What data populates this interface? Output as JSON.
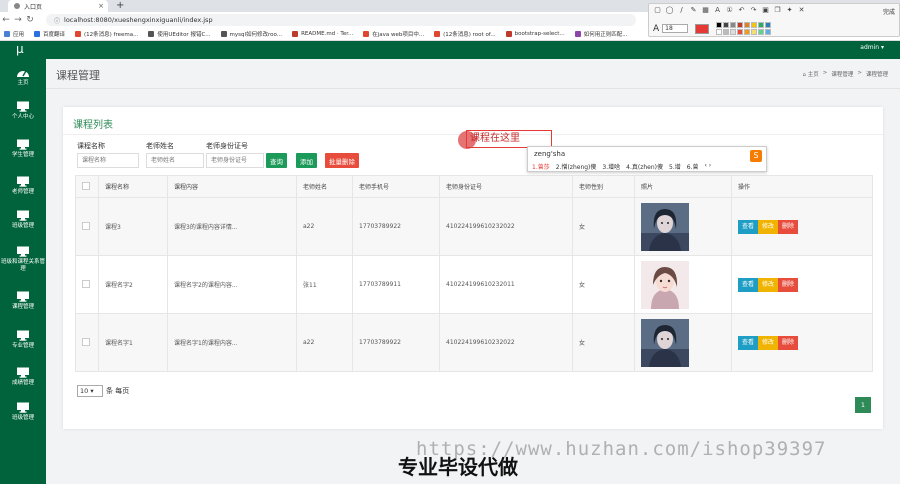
{
  "browser": {
    "tab_title": "入口页",
    "tab_close": "×",
    "new_tab": "+",
    "url": "localhost:8080/xueshengxinxiguanli/index.jsp",
    "bookmarks": [
      {
        "label": "应用",
        "color": "#4a7fd6"
      },
      {
        "label": "百度翻译",
        "color": "#2b6fe0"
      },
      {
        "label": "(12条消息) freema...",
        "color": "#e0472f"
      },
      {
        "label": "使用UEditor 报错C...",
        "color": "#555555"
      },
      {
        "label": "mysql如何修改roo...",
        "color": "#555555"
      },
      {
        "label": "README.md · Ter...",
        "color": "#c0392b"
      },
      {
        "label": "在java web项目中...",
        "color": "#e0472f"
      },
      {
        "label": "(12条消息) root of...",
        "color": "#e0472f"
      },
      {
        "label": "bootstrap-select...",
        "color": "#c0392b"
      },
      {
        "label": "如何用正则匹配...",
        "color": "#8e44ad"
      }
    ]
  },
  "annot_toolbar": {
    "done": "完成",
    "font_size": "18",
    "current_color": "#e53935",
    "palette": [
      "#000000",
      "#444444",
      "#888888",
      "#c0392b",
      "#e67e22",
      "#f1c40f",
      "#27ae60",
      "#2980b9",
      "#ffffff",
      "#bbbbbb",
      "#dddddd",
      "#e74c3c",
      "#f39c12",
      "#f7dc6f",
      "#58d68d",
      "#5dade2"
    ]
  },
  "header": {
    "brand": "μ",
    "admin": "admin ▾"
  },
  "sidebar": {
    "items": [
      {
        "label": "主页",
        "icon": "dashboard-icon"
      },
      {
        "label": "个人中心",
        "icon": "monitor-icon"
      },
      {
        "label": "学生管理",
        "icon": "monitor-icon"
      },
      {
        "label": "老师管理",
        "icon": "monitor-icon"
      },
      {
        "label": "班级管理",
        "icon": "monitor-icon"
      },
      {
        "label": "班级和课程关系管理",
        "icon": "monitor-icon"
      },
      {
        "label": "课程管理",
        "icon": "monitor-icon"
      },
      {
        "label": "专业管理",
        "icon": "monitor-icon"
      },
      {
        "label": "成绩管理",
        "icon": "monitor-icon"
      },
      {
        "label": "班级管理",
        "icon": "monitor-icon"
      }
    ]
  },
  "page": {
    "title": "课程管理",
    "breadcrumb_home": "⌂ 主页",
    "breadcrumb_sep": ">",
    "breadcrumb_mid": "课程管理",
    "breadcrumb_current": "课程管理"
  },
  "panel": {
    "title": "课程列表"
  },
  "filters": {
    "course_name_label": "课程名称",
    "course_name_placeholder": "课程名称",
    "teacher_name_label": "老师姓名",
    "teacher_name_placeholder": "老师姓名",
    "teacher_id_label": "老师身份证号",
    "teacher_id_placeholder": "老师身份证号",
    "search_btn": "查询",
    "add_btn": "添加",
    "batch_delete_btn": "批量删除"
  },
  "table": {
    "headers": [
      "课程名称",
      "课程内容",
      "老师姓名",
      "老师手机号",
      "老师身份证号",
      "老师性别",
      "照片",
      "操作"
    ],
    "rows": [
      {
        "name": "课程3",
        "content": "课程3的课程内容详情...",
        "teacher": "a22",
        "phone": "17703789922",
        "id_no": "410224199610232022",
        "gender": "女"
      },
      {
        "name": "课程名字2",
        "content": "课程名字2的课程内容...",
        "teacher": "张11",
        "phone": "17703789911",
        "id_no": "410224199610232011",
        "gender": "女"
      },
      {
        "name": "课程名字1",
        "content": "课程名字1的课程内容...",
        "teacher": "a22",
        "phone": "17703789922",
        "id_no": "410224199610232022",
        "gender": "女"
      }
    ],
    "actions": {
      "view": "查看",
      "edit": "修改",
      "delete": "删除"
    }
  },
  "pagination": {
    "page_size": "10",
    "page_size_suffix": "条 每页",
    "current_page": "1"
  },
  "overlay": {
    "callout_text": "课程在这里",
    "ime_input": "zeng'sha",
    "ime_candidates": [
      "1.曾莎",
      "2.憎(zheng)傻",
      "3.增啥",
      "4.真(zhen)傻",
      "5.增",
      "6.曾",
      "‹ ›"
    ],
    "ime_logo": "S"
  },
  "watermark": {
    "url": "https://www.huzhan.com/ishop39397",
    "text": "专业毕设代做"
  }
}
